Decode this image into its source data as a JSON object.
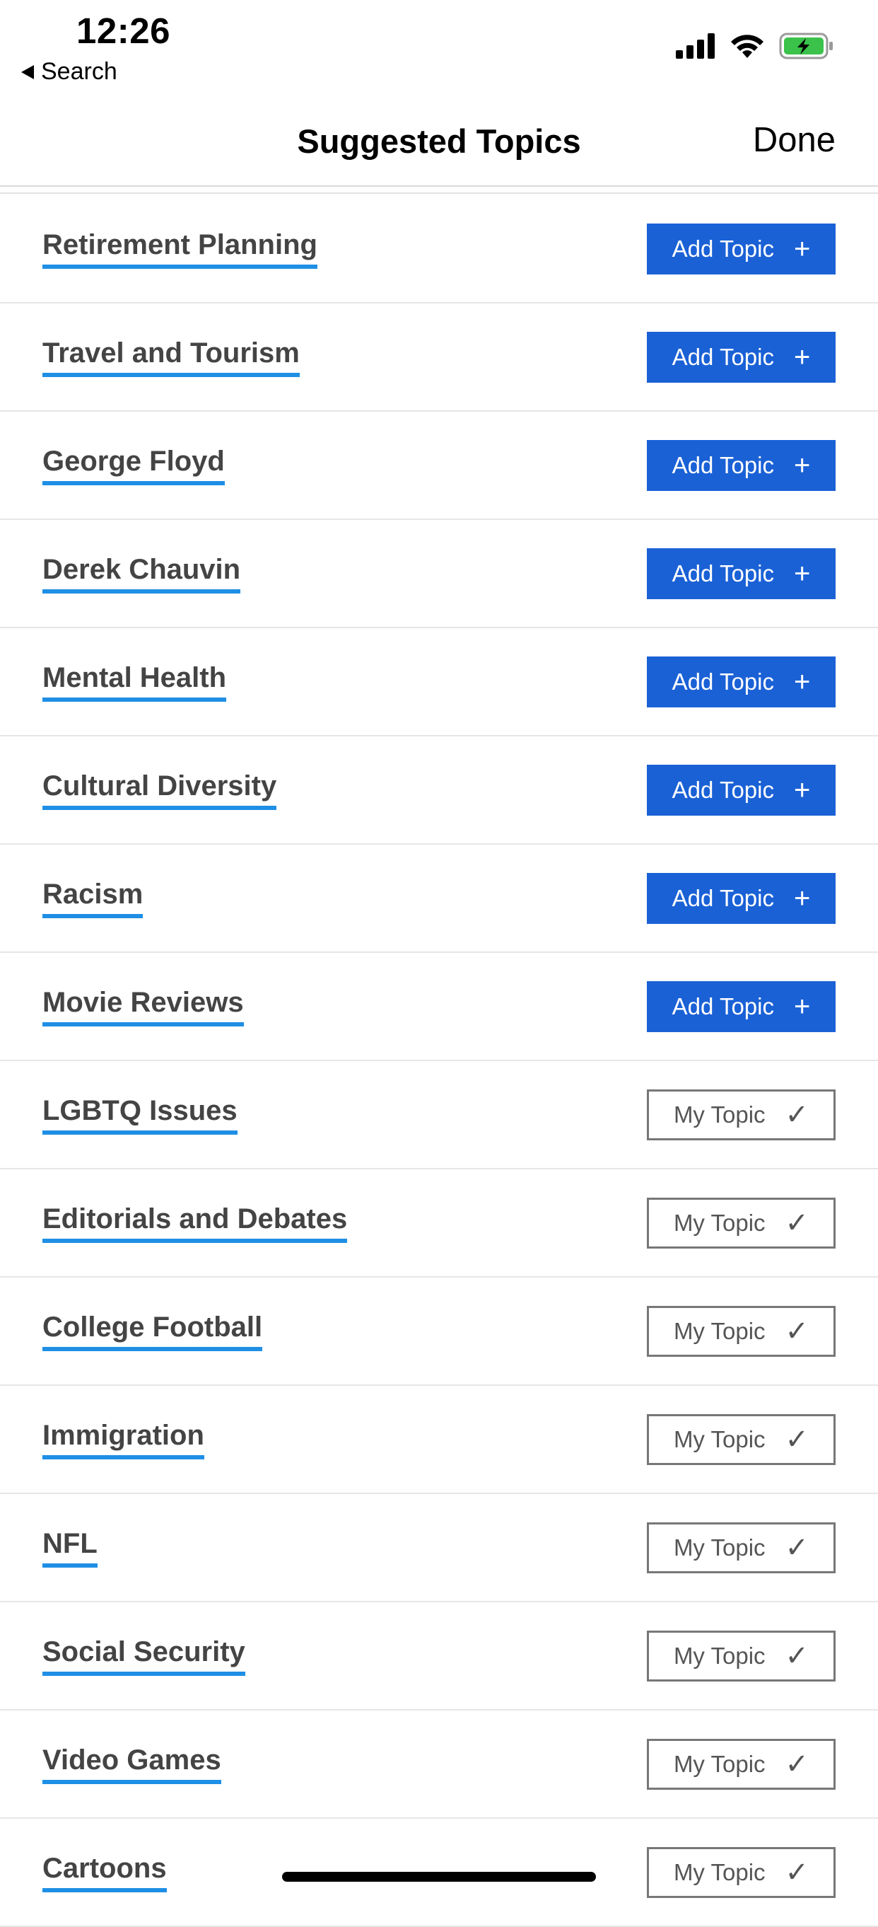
{
  "status_bar": {
    "time": "12:26",
    "back_label": "Search",
    "icons": [
      "cellular-signal-icon",
      "wifi-icon",
      "battery-charging-icon"
    ],
    "battery_color": "#3ac24a"
  },
  "nav": {
    "title": "Suggested Topics",
    "done_label": "Done"
  },
  "colors": {
    "add_button": "#1a61d6",
    "underline": "#1f8fe5",
    "topic_text": "#444444"
  },
  "topics": [
    {
      "name": "Retirement Planning",
      "action": "Add Topic",
      "glyph": "+"
    },
    {
      "name": "Travel and Tourism",
      "action": "Add Topic",
      "glyph": "+"
    },
    {
      "name": "George Floyd",
      "action": "Add Topic",
      "glyph": "+"
    },
    {
      "name": "Derek Chauvin",
      "action": "Add Topic",
      "glyph": "+"
    },
    {
      "name": "Mental Health",
      "action": "Add Topic",
      "glyph": "+"
    },
    {
      "name": "Cultural Diversity",
      "action": "Add Topic",
      "glyph": "+"
    },
    {
      "name": "Racism",
      "action": "Add Topic",
      "glyph": "+"
    },
    {
      "name": "Movie Reviews",
      "action": "Add Topic",
      "glyph": "+"
    },
    {
      "name": "LGBTQ Issues",
      "action": "My Topic",
      "glyph": "✓"
    },
    {
      "name": "Editorials and Debates",
      "action": "My Topic",
      "glyph": "✓"
    },
    {
      "name": "College Football",
      "action": "My Topic",
      "glyph": "✓"
    },
    {
      "name": "Immigration",
      "action": "My Topic",
      "glyph": "✓"
    },
    {
      "name": "NFL",
      "action": "My Topic",
      "glyph": "✓"
    },
    {
      "name": "Social Security",
      "action": "My Topic",
      "glyph": "✓"
    },
    {
      "name": "Video Games",
      "action": "My Topic",
      "glyph": "✓"
    },
    {
      "name": "Cartoons",
      "action": "My Topic",
      "glyph": "✓"
    }
  ]
}
